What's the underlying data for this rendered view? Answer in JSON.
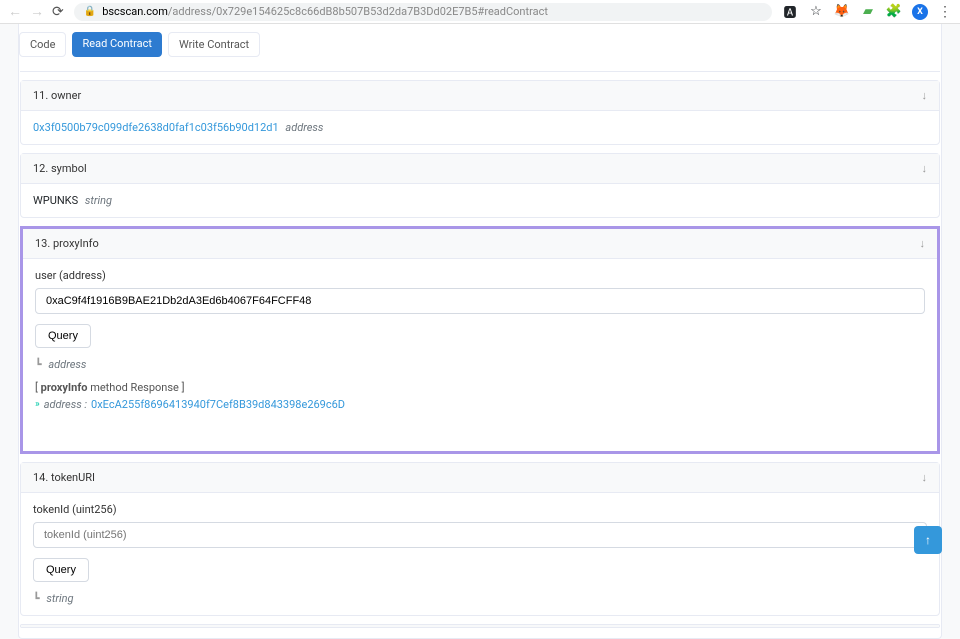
{
  "browser": {
    "url_domain": "bscscan.com",
    "url_path": "/address/0x729e154625c8c66dB8b507B53d2da7B3Dd02E7B5#readContract",
    "avatar_letter": "X"
  },
  "tabs": {
    "code": "Code",
    "read": "Read Contract",
    "write": "Write Contract"
  },
  "sections": {
    "owner": {
      "title": "11. owner",
      "value": "0x3f0500b79c099dfe2638d0faf1c03f56b90d12d1",
      "type": "address"
    },
    "symbol": {
      "title": "12. symbol",
      "value": "WPUNKS",
      "type": "string"
    },
    "proxyInfo": {
      "title": "13. proxyInfo",
      "param_label": "user (address)",
      "param_value": "0xaC9f4f1916B9BAE21Db2dA3Ed6b4067F64FCFF48",
      "query": "Query",
      "return_type": "address",
      "response_title": "[ proxyInfo method Response ]",
      "response_label": "address :",
      "response_value": "0xEcA255f8696413940f7Cef8B39d843398e269c6D"
    },
    "tokenURI": {
      "title": "14. tokenURI",
      "param_label": "tokenId (uint256)",
      "param_placeholder": "tokenId (uint256)",
      "query": "Query",
      "return_type": "string"
    }
  }
}
